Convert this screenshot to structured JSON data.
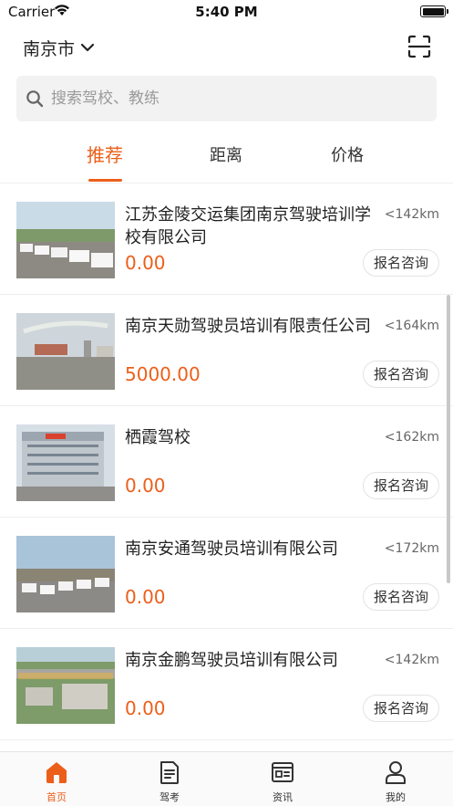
{
  "status_bar": {
    "carrier": "Carrier",
    "time": "5:40 PM",
    "battery_level": 1.0
  },
  "header": {
    "city": "南京市",
    "scan_icon": "scan-icon",
    "chevron_icon": "chevron-down-icon"
  },
  "search": {
    "placeholder": "搜索驾校、教练",
    "value": "",
    "icon": "search-icon"
  },
  "tabs": [
    {
      "label": "推荐",
      "active": true
    },
    {
      "label": "距离",
      "active": false
    },
    {
      "label": "价格",
      "active": false
    }
  ],
  "schools": [
    {
      "name": "江苏金陵交运集团南京驾驶培训学校有限公司",
      "price": "0.00",
      "distance": "<142km",
      "button": "报名咨询"
    },
    {
      "name": "南京天勋驾驶员培训有限责任公司",
      "price": "5000.00",
      "distance": "<164km",
      "button": "报名咨询"
    },
    {
      "name": "栖霞驾校",
      "price": "0.00",
      "distance": "<162km",
      "button": "报名咨询"
    },
    {
      "name": "南京安通驾驶员培训有限公司",
      "price": "0.00",
      "distance": "<172km",
      "button": "报名咨询"
    },
    {
      "name": "南京金鹏驾驶员培训有限公司",
      "price": "0.00",
      "distance": "<142km",
      "button": "报名咨询"
    }
  ],
  "tabbar": [
    {
      "label": "首页",
      "icon": "home-icon",
      "active": true
    },
    {
      "label": "驾考",
      "icon": "document-icon",
      "active": false
    },
    {
      "label": "资讯",
      "icon": "news-icon",
      "active": false
    },
    {
      "label": "我的",
      "icon": "user-icon",
      "active": false
    }
  ],
  "colors": {
    "accent": "#ec5f1a",
    "search_bg": "#f2f2f2",
    "divider": "#eeeeee"
  }
}
